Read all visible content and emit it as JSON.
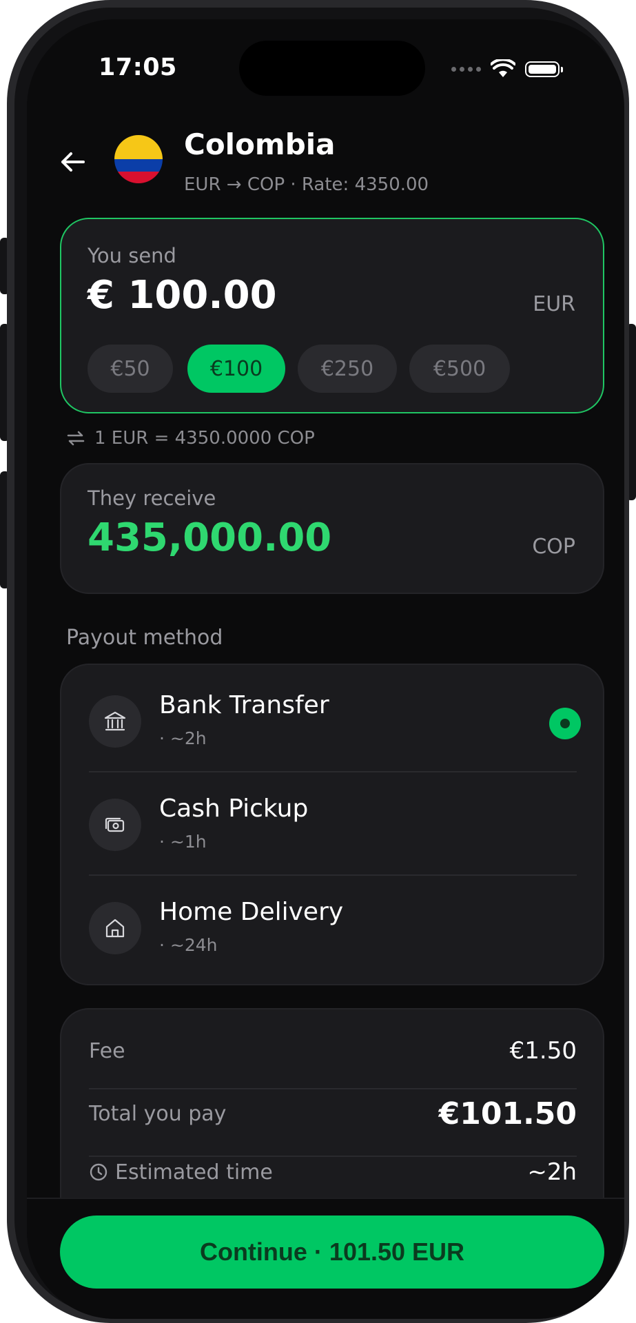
{
  "status_bar": {
    "time": "17:05"
  },
  "header": {
    "country": "Colombia",
    "subtitle": "EUR → COP · Rate: 4350.00"
  },
  "send": {
    "label": "You send",
    "amount": "€ 100.00",
    "currency": "EUR",
    "presets": [
      "€50",
      "€100",
      "€250",
      "€500"
    ],
    "selected_preset": "€100"
  },
  "fx": {
    "text": "1 EUR = 4350.0000 COP"
  },
  "receive": {
    "label": "They receive",
    "amount": "435,000.00",
    "currency": "COP"
  },
  "payout": {
    "title": "Payout method",
    "methods": [
      {
        "name": "Bank Transfer",
        "eta": " · ~2h",
        "icon": "bank-icon",
        "selected": true
      },
      {
        "name": "Cash Pickup",
        "eta": " · ~1h",
        "icon": "cash-icon",
        "selected": false
      },
      {
        "name": "Home Delivery",
        "eta": " · ~24h",
        "icon": "home-icon",
        "selected": false
      }
    ]
  },
  "summary": {
    "fee_label": "Fee",
    "fee_value": "€1.50",
    "total_label": "Total you pay",
    "total_value": "€101.50",
    "eta_label": "Estimated time",
    "eta_value": "~2h"
  },
  "cta": {
    "label": "Continue · 101.50 EUR"
  },
  "colors": {
    "accent": "#00c763",
    "receive_amount": "#2fd870",
    "background": "#0b0b0c",
    "card": "#1b1b1e"
  }
}
